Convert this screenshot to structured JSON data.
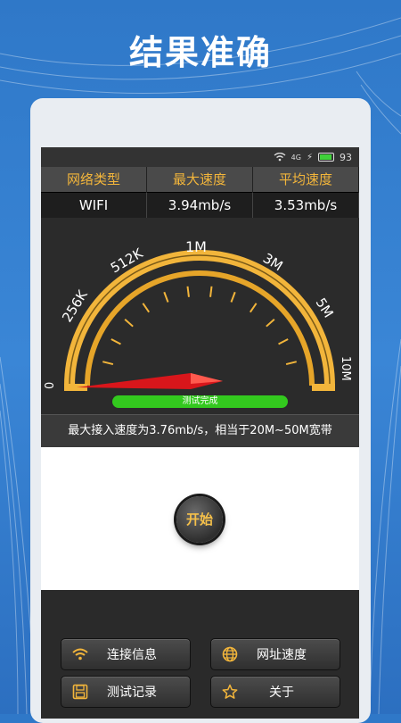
{
  "headline": "结果准确",
  "status_bar": {
    "signal_label": "4G",
    "battery": "93"
  },
  "stats": {
    "headers": [
      "网络类型",
      "最大速度",
      "平均速度"
    ],
    "values": [
      "WIFI",
      "3.94mb/s",
      "3.53mb/s"
    ]
  },
  "gauge": {
    "labels": [
      "0",
      "256K",
      "512K",
      "1M",
      "3M",
      "5M",
      "10M"
    ],
    "progress_label": "测试完成"
  },
  "result_text": "最大接入速度为3.76mb/s，相当于20M~50M宽带",
  "start_button": "开始",
  "menu": {
    "items": [
      {
        "label": "连接信息",
        "icon": "wifi-icon"
      },
      {
        "label": "网址速度",
        "icon": "globe-icon"
      },
      {
        "label": "测试记录",
        "icon": "save-icon"
      },
      {
        "label": "关于",
        "icon": "star-icon"
      }
    ]
  },
  "colors": {
    "accent": "#f2b53b",
    "progress": "#33c91e",
    "needle": "#d8161b"
  }
}
